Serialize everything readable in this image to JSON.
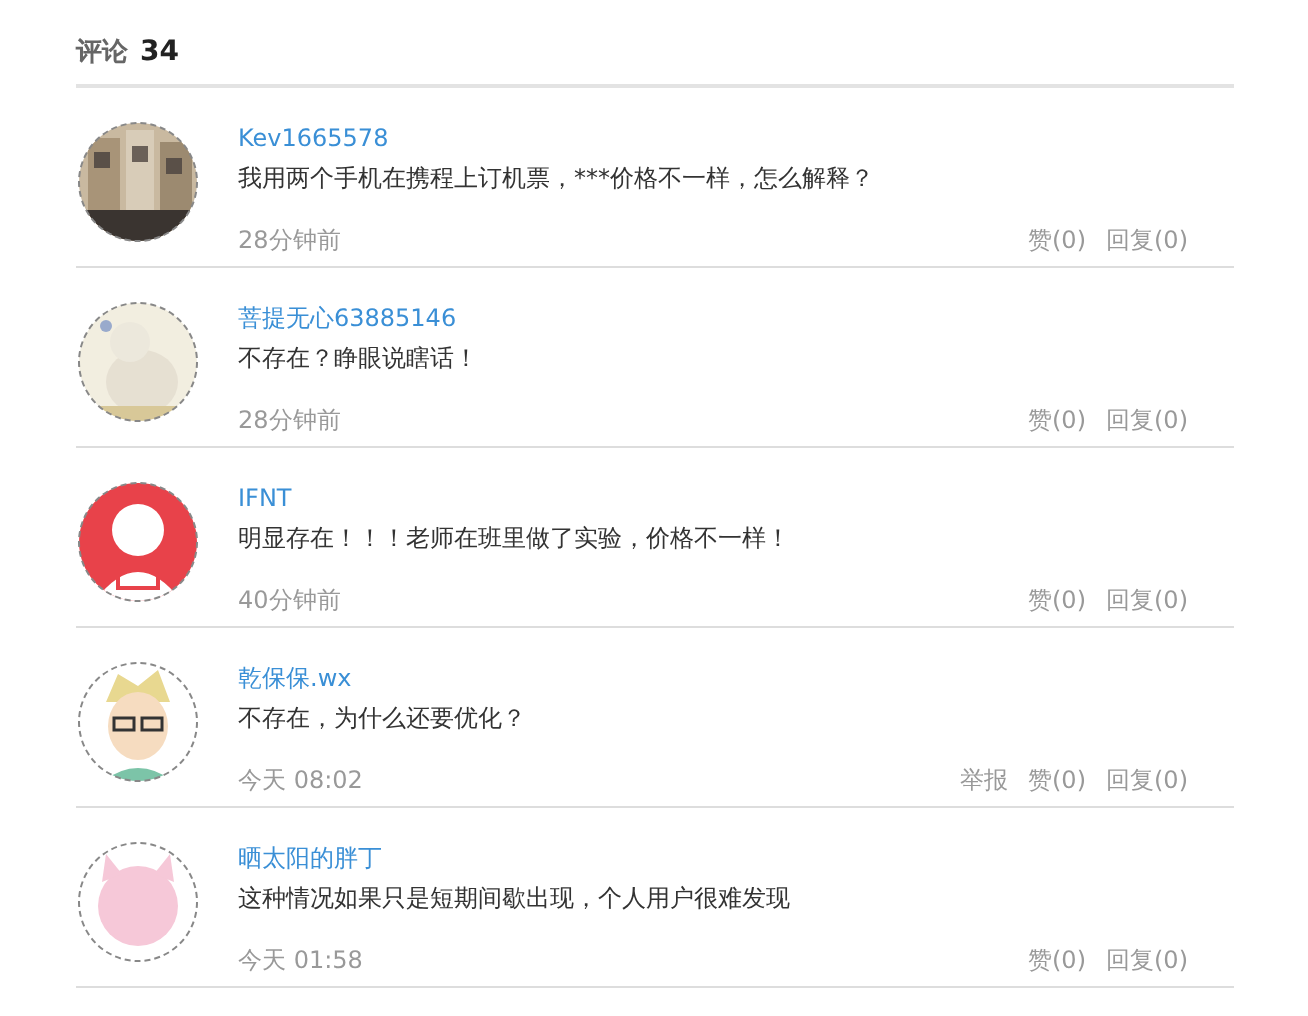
{
  "header": {
    "label": "评论",
    "count": "34"
  },
  "comments": [
    {
      "kind": "building",
      "user": "Kev1665578",
      "text": "我用两个手机在携程上订机票，***价格不一样，怎么解释？",
      "time": "28分钟前",
      "actions": [
        "赞(0)",
        "回复(0)"
      ]
    },
    {
      "kind": "pale",
      "user": "菩提无心63885146",
      "text": "不存在？睁眼说瞎话！",
      "time": "28分钟前",
      "actions": [
        "赞(0)",
        "回复(0)"
      ]
    },
    {
      "kind": "person",
      "user": "IFNT",
      "text": "明显存在！！！老师在班里做了实验，价格不一样！",
      "time": "40分钟前",
      "actions": [
        "赞(0)",
        "回复(0)"
      ]
    },
    {
      "kind": "cartoon",
      "user": "乾保保.wx",
      "text": "不存在，为什么还要优化？",
      "time": "今天 08:02",
      "actions": [
        "举报",
        "赞(0)",
        "回复(0)"
      ]
    },
    {
      "kind": "pink",
      "user": "晒太阳的胖丁",
      "text": "这种情况如果只是短期间歇出现，个人用户很难发现",
      "time": "今天 01:58",
      "actions": [
        "赞(0)",
        "回复(0)"
      ]
    }
  ]
}
